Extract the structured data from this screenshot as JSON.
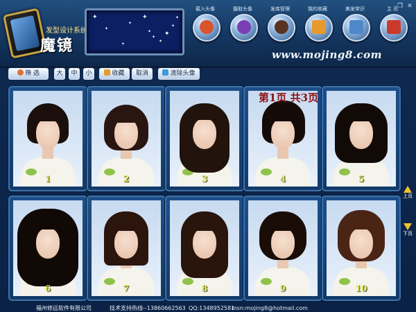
{
  "header": {
    "logo_subtitle": "发型设计系统",
    "logo_title": "魔镜",
    "url": "www.mojing8.com"
  },
  "nav": [
    {
      "label": "载入头像",
      "icon": "user-icon",
      "color": "#d9532b"
    },
    {
      "label": "摄取头像",
      "icon": "webcam-icon",
      "color": "#7b3fb5"
    },
    {
      "label": "发库管理",
      "icon": "hair-icon",
      "color": "#5a3421"
    },
    {
      "label": "我的收藏",
      "icon": "folder-icon",
      "color": "#e79a2b"
    },
    {
      "label": "美发常识",
      "icon": "book-icon",
      "color": "#4f88c8"
    },
    {
      "label": "主 页",
      "icon": "home-icon",
      "color": "#c93a2b"
    }
  ],
  "toolbar": {
    "filter": "筛 选",
    "size_large": "大",
    "size_medium": "中",
    "size_small": "小",
    "favorite": "收藏",
    "cancel": "取消",
    "clear": "清除头像"
  },
  "page_indicator": "第1页  共3页",
  "styles": [
    {
      "number": "1"
    },
    {
      "number": "2"
    },
    {
      "number": "3"
    },
    {
      "number": "4"
    },
    {
      "number": "5"
    },
    {
      "number": "6"
    },
    {
      "number": "7"
    },
    {
      "number": "8"
    },
    {
      "number": "9"
    },
    {
      "number": "10"
    }
  ],
  "pager": {
    "up": "上页",
    "down": "下页"
  },
  "status": {
    "company": "福州修远软件有限公司",
    "support": "技术支持热线--13860662563",
    "qq": "QQ:1348952581",
    "msn": "msn:mojing8@hotmail.com"
  },
  "colors": {
    "accent": "#1d4f89",
    "number_color": "#e8e25a",
    "page_indicator_color": "#8b1111"
  }
}
